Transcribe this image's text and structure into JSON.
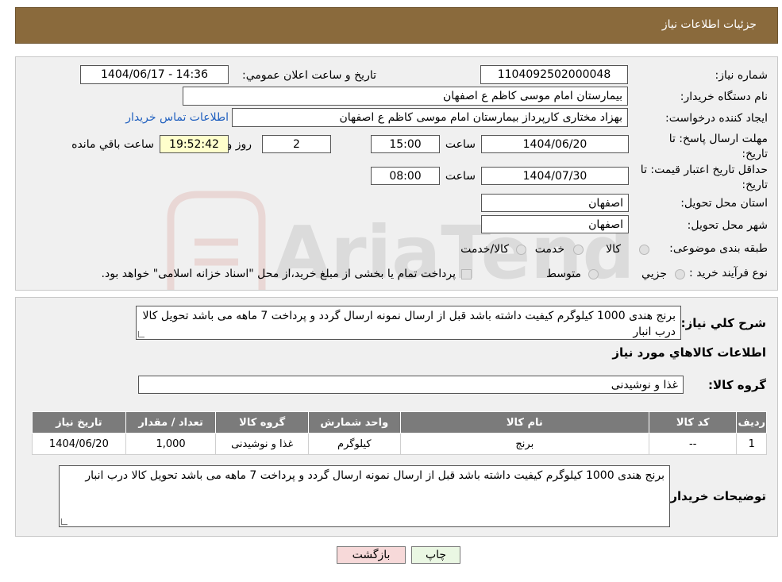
{
  "header": {
    "title": "جزئیات اطلاعات نیاز"
  },
  "form": {
    "need_number_label": "شماره نیاز:",
    "need_number": "1104092502000048",
    "announce_label": "تاریخ و ساعت اعلان عمومي:",
    "announce_value": "1404/06/17 - 14:36",
    "buyer_org_label": "نام دستگاه خريدار:",
    "buyer_org": "بیمارستان امام موسی کاظم ع  اصفهان",
    "creator_label": "ایجاد کننده درخواست:",
    "creator": "بهزاد مختاری کارپرداز بیمارستان امام موسی کاظم ع  اصفهان",
    "contact_link": "اطلاعات تماس خریدار",
    "deadline_label": "مهلت ارسال پاسخ: تا تاریخ:",
    "deadline_date": "1404/06/20",
    "time_label": "ساعت",
    "deadline_time": "15:00",
    "days_value": "2",
    "days_label": "روز و",
    "remaining_time": "19:52:42",
    "remaining_label": "ساعت باقي مانده",
    "validity_label": "حداقل تاريخ اعتبار قيمت: تا تاریخ:",
    "validity_date": "1404/07/30",
    "validity_time": "08:00",
    "province_label": "استان محل تحویل:",
    "province": "اصفهان",
    "city_label": "شهر محل تحویل:",
    "city": "اصفهان",
    "category_label": "طبقه بندی موضوعی:",
    "category_options": [
      "کالا",
      "خدمت",
      "کالا/خدمت"
    ],
    "process_label": "نوع فرآیند خرید :",
    "process_options": [
      "جزيي",
      "متوسط"
    ],
    "process_note": "پرداخت تمام یا بخشی از مبلغ خرید،از محل \"اسناد خزانه اسلامی\" خواهد بود."
  },
  "summary": {
    "desc_label": "شرح کلي نياز:",
    "description": "برنج هندی 1000 کیلوگرم کیفیت داشته باشد قبل از ارسال نمونه ارسال گردد و پرداخت 7 ماهه می باشد تحویل کالا درب انبار",
    "goods_section_title": "اطلاعات کالاهاي مورد نياز",
    "group_label": "گروه کالا:",
    "group_value": "غذا و نوشیدنی"
  },
  "table": {
    "headers": [
      "رديف",
      "کد کالا",
      "نام کالا",
      "واحد شمارش",
      "گروه کالا",
      "تعداد / مقدار",
      "تاریخ نیاز"
    ],
    "rows": [
      [
        "1",
        "--",
        "برنج",
        "کیلوگرم",
        "غذا و نوشیدنی",
        "1,000",
        "1404/06/20"
      ]
    ]
  },
  "buyer_notes": {
    "label": "توضیحات خریدار:",
    "text": "برنج هندی 1000 کیلوگرم کیفیت داشته باشد قبل از ارسال نمونه ارسال گردد و پرداخت 7 ماهه می باشد تحویل کالا درب انبار"
  },
  "buttons": {
    "print": "چاپ",
    "back": "بازگشت"
  },
  "watermark": {
    "text": "AriaTender.neT"
  },
  "colors": {
    "header_bg": "#8a6a3c",
    "table_header_bg": "#7b7b7b",
    "back_button_bg": "#f7d9d9",
    "print_button_bg": "#eaf7e3"
  }
}
